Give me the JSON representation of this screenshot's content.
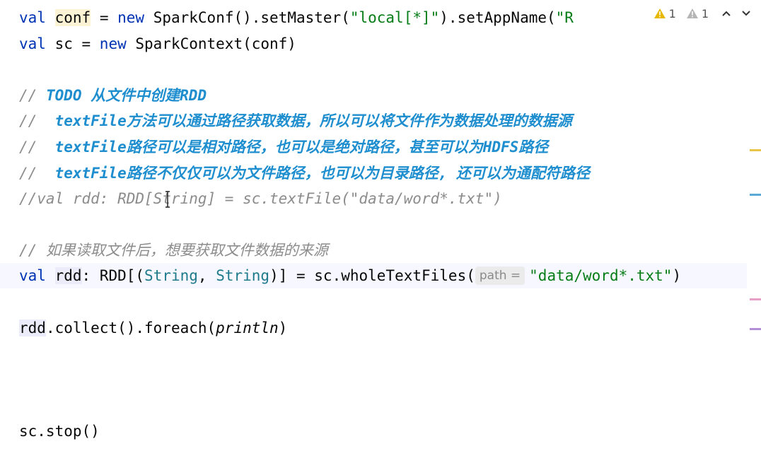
{
  "editor": {
    "line1": {
      "kw_val": "val",
      "var_conf": "conf",
      "eq": " = ",
      "kw_new": "new",
      "rest": " SparkConf().setMaster(",
      "str_master": "\"local[*]\"",
      "rest2": ").setAppName(",
      "str_app": "\"R"
    },
    "line2": {
      "kw_val": "val",
      "rest": " sc = ",
      "kw_new": "new",
      "rest2": " SparkContext(conf)"
    },
    "line3": {
      "prefix": "// ",
      "todo": "TODO 从文件中创建RDD"
    },
    "line4": {
      "prefix": "//  ",
      "doc": "textFile方法可以通过路径获取数据，所以可以将文件作为数据处理的数据源"
    },
    "line5": {
      "prefix": "//  ",
      "doc": "textFile路径可以是相对路径，也可以是绝对路径，甚至可以为HDFS路径"
    },
    "line6": {
      "prefix": "//  ",
      "doc": "textFile路径不仅仅可以为文件路径，也可以为目录路径, 还可以为通配符路径"
    },
    "line7": {
      "text": "//val rdd: RDD[String] = sc.textFile(\"data/word*.txt\")"
    },
    "line8": {
      "text": "// 如果读取文件后，想要获取文件数据的来源"
    },
    "line9": {
      "kw_val": "val",
      "var_rdd": "rdd",
      "p1": ": RDD[(",
      "t1": "String",
      "p2": ", ",
      "t2": "String",
      "p3": ")] = sc.wholeTextFiles(",
      "hint": "path =",
      "str_path": "\"data/word*.txt\"",
      "p4": ")"
    },
    "line10": {
      "ref_rdd": "rdd",
      "p1": ".collect().foreach(",
      "fn": "println",
      "p2": ")"
    },
    "line11": {
      "text": "sc.stop()"
    }
  },
  "inspections": {
    "warnings_count": "1",
    "weak_warnings_count": "1",
    "warning_icon": "warning-triangle-icon",
    "weak_warning_icon": "weak-warning-triangle-icon"
  },
  "colors": {
    "keyword": "#0033b3",
    "string": "#067d17",
    "comment": "#8c8c8c",
    "doc_comment": "#1f8ecf",
    "warning": "#e6b800",
    "weak_warning": "#a0a0a0"
  }
}
